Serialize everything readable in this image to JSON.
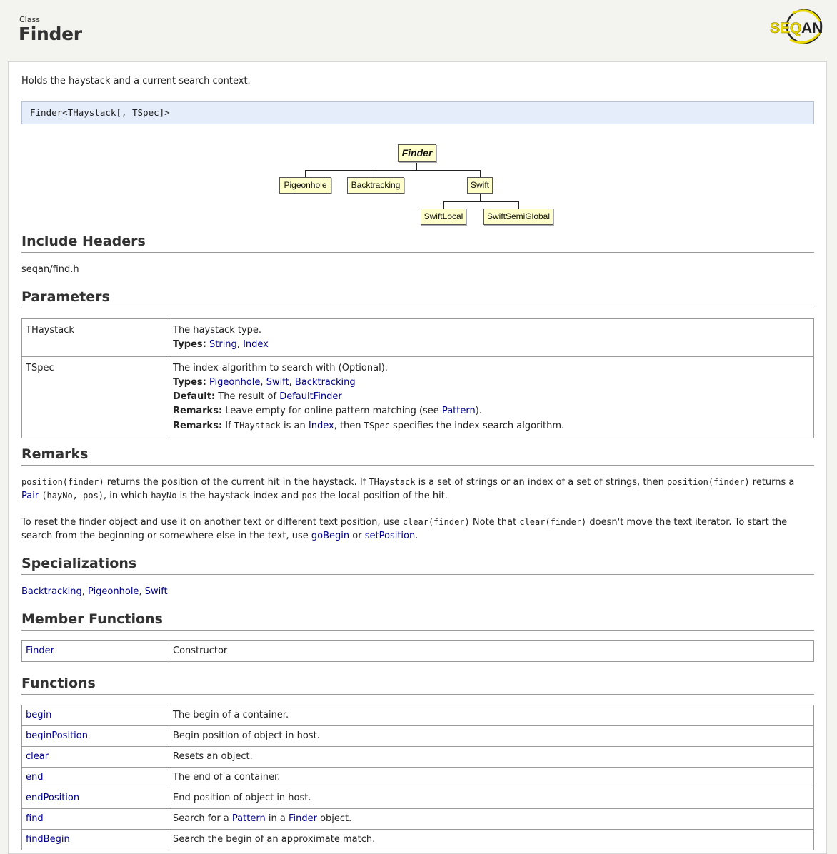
{
  "header": {
    "kind": "Class",
    "title": "Finder",
    "logo_text": "SEQAN"
  },
  "description": "Holds the haystack and a current search context.",
  "signature": "Finder<THaystack[, TSpec]>",
  "diagram": {
    "root": "Finder",
    "children": [
      "Pigeonhole",
      "Backtracking",
      "Swift"
    ],
    "swift_children": [
      "SwiftLocal",
      "SwiftSemiGlobal"
    ]
  },
  "sections": {
    "include": "Include Headers",
    "parameters": "Parameters",
    "remarks": "Remarks",
    "specializations": "Specializations",
    "member_functions": "Member Functions",
    "functions": "Functions"
  },
  "include_header": "seqan/find.h",
  "parameters": {
    "thaystack": {
      "name": "THaystack",
      "desc": "The haystack type.",
      "types_label": "Types:",
      "types": [
        "String",
        "Index"
      ]
    },
    "tspec": {
      "name": "TSpec",
      "desc": "The index-algorithm to search with (Optional).",
      "types_label": "Types:",
      "types": [
        "Pigeonhole",
        "Swift",
        "Backtracking"
      ],
      "default_label": "Default:",
      "default_text": "The result of",
      "default_link": "DefaultFinder",
      "remarks_label": "Remarks:",
      "remark1_pre": "Leave empty for online pattern matching (see",
      "remark1_link": "Pattern",
      "remark1_post": ").",
      "remark2_if": "If",
      "remark2_code1": "THaystack",
      "remark2_is": "is an",
      "remark2_link": "Index",
      "remark2_then": ", then",
      "remark2_code2": "TSpec",
      "remark2_post": "specifies the index search algorithm."
    }
  },
  "remarks": {
    "p1_code1": "position(finder)",
    "p1_t1": "returns the position of the current hit in the haystack. If",
    "p1_code2": "THaystack",
    "p1_t2": "is a set of strings or an index of a set of strings, then",
    "p1_code3": "position(finder)",
    "p1_t3": "returns a",
    "p1_link": "Pair",
    "p1_code4": "(hayNo, pos)",
    "p1_t4": ", in which",
    "p1_code5": "hayNo",
    "p1_t5": "is the haystack index and",
    "p1_code6": "pos",
    "p1_t6": "the local position of the hit.",
    "p2_t1": "To reset the finder object and use it on another text or different text position, use",
    "p2_code1": "clear(finder)",
    "p2_t2": "Note that",
    "p2_code2": "clear(finder)",
    "p2_t3": "doesn't move the text iterator. To start the search from the beginning or somewhere else in the text, use",
    "p2_link1": "goBegin",
    "p2_or": "or",
    "p2_link2": "setPosition",
    "p2_end": "."
  },
  "specializations": [
    "Backtracking",
    "Pigeonhole",
    "Swift"
  ],
  "member_functions": [
    {
      "name": "Finder",
      "desc": "Constructor"
    }
  ],
  "functions": [
    {
      "name": "begin",
      "desc": "The begin of a container."
    },
    {
      "name": "beginPosition",
      "desc": "Begin position of object in host."
    },
    {
      "name": "clear",
      "desc": "Resets an object."
    },
    {
      "name": "end",
      "desc": "The end of a container."
    },
    {
      "name": "endPosition",
      "desc": "End position of object in host."
    },
    {
      "name": "find",
      "desc_pre": "Search for a",
      "desc_link1": "Pattern",
      "desc_mid": "in a",
      "desc_link2": "Finder",
      "desc_post": "object."
    },
    {
      "name": "findBegin",
      "desc": "Search the begin of an approximate match."
    }
  ],
  "colors": {
    "link": "#00008b",
    "signature_bg": "#e5edfa",
    "node_bg": "#ffffcc",
    "logo_yellow": "#e8d800"
  }
}
